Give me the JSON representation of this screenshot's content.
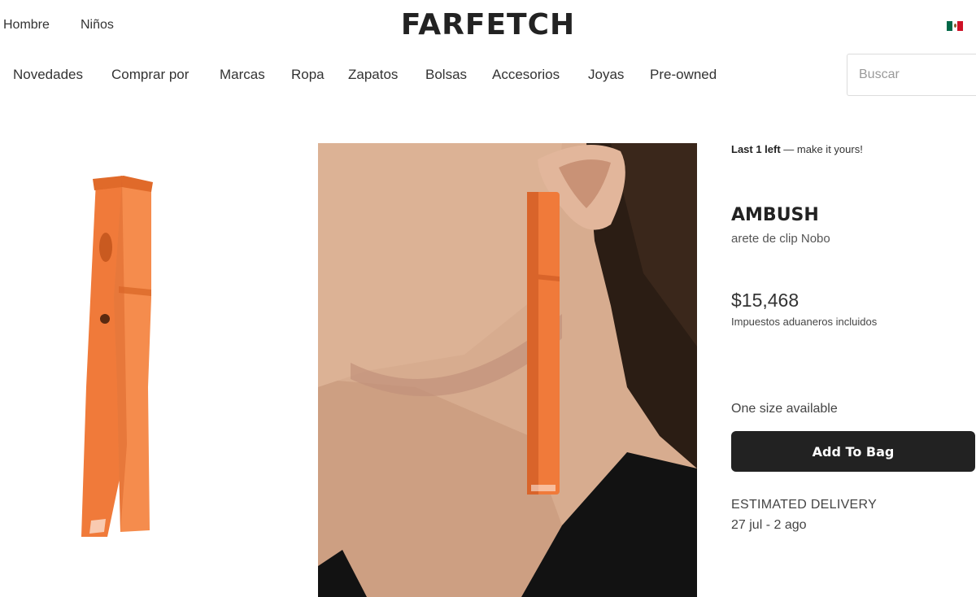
{
  "header": {
    "gender_links": [
      "Hombre",
      "Niños"
    ],
    "logo": "FARFETCH",
    "flag_colors": [
      "#006847",
      "#ffffff",
      "#ce1126"
    ]
  },
  "nav": {
    "items": [
      "Novedades",
      "Comprar por",
      "Marcas",
      "Ropa",
      "Zapatos",
      "Bolsas",
      "Accesorios",
      "Joyas",
      "Pre-owned"
    ],
    "search_placeholder": "Buscar"
  },
  "product": {
    "stock_strong": "Last 1 left",
    "stock_rest": " — make it yours!",
    "brand": "AMBUSH",
    "name": "arete de clip Nobo",
    "price": "$15,468",
    "tax_note": "Impuestos aduaneros incluidos",
    "size_note": "One size available",
    "add_to_bag": "Add To Bag",
    "delivery_label": "ESTIMATED DELIVERY",
    "delivery_dates": "27 jul - 2 ago"
  },
  "colors": {
    "accent_orange": "#f07a3a",
    "button_dark": "#222222"
  }
}
